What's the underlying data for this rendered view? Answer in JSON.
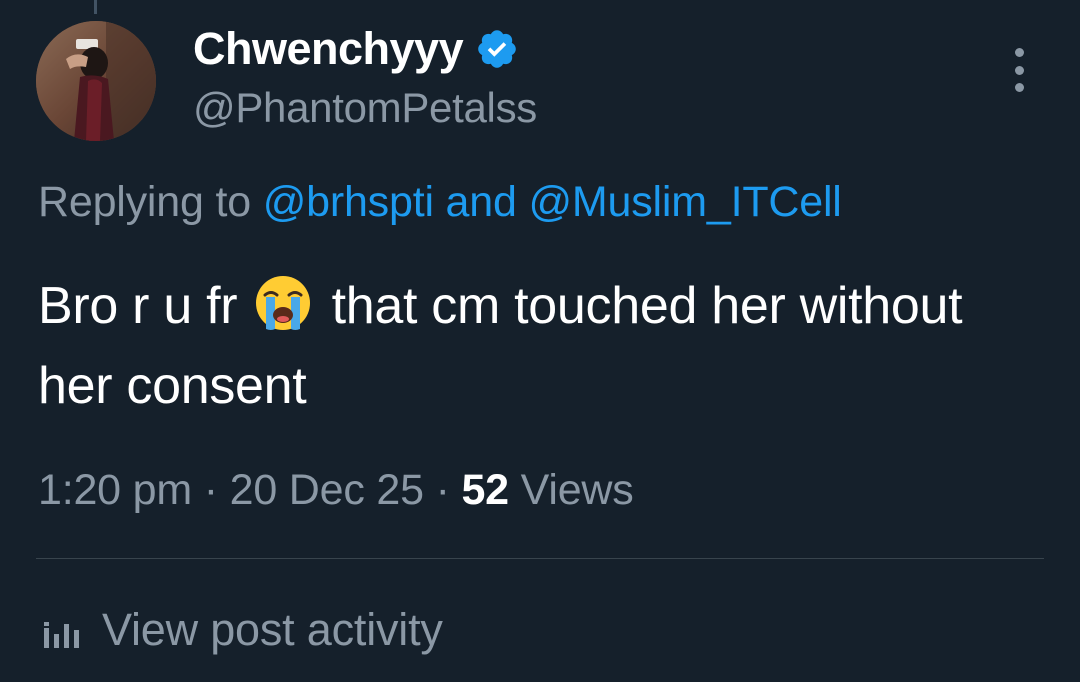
{
  "author": {
    "display_name": "Chwenchyyy",
    "handle": "@PhantomPetalss",
    "verified": true,
    "verified_icon": "verified-badge-icon",
    "avatar": "profile-photo"
  },
  "reply": {
    "prefix": "Replying to ",
    "mention_1": "@brhspti",
    "joiner": " and ",
    "mention_2": "@Muslim_ITCell"
  },
  "tweet": {
    "text_before_emoji": "Bro r u fr ",
    "emoji": "loudly-crying-face-icon",
    "text_after_emoji": " that cm touched her without her consent"
  },
  "meta": {
    "time": "1:20 pm",
    "separator": " · ",
    "date": "20 Dec 25",
    "views_count": "52",
    "views_label": " Views"
  },
  "activity": {
    "label": "View post activity",
    "icon": "analytics-icon"
  },
  "colors": {
    "background": "#15202b",
    "text_primary": "#ffffff",
    "text_secondary": "#8b98a5",
    "accent": "#1d9bf0",
    "divider": "#38444d"
  }
}
